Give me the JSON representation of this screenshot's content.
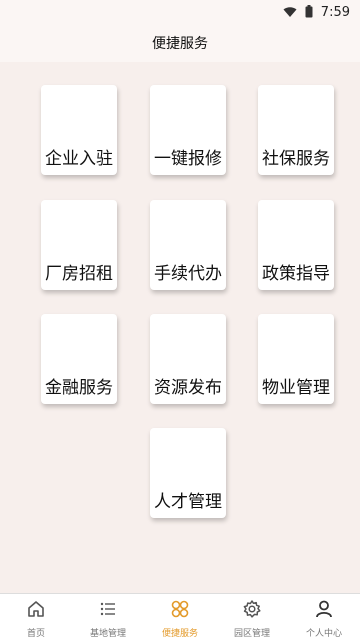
{
  "status_bar": {
    "time": "7:59",
    "icons": [
      "wifi-icon",
      "battery-icon"
    ]
  },
  "header": {
    "title": "便捷服务"
  },
  "services": [
    {
      "label": "企业入驻"
    },
    {
      "label": "一键报修"
    },
    {
      "label": "社保服务"
    },
    {
      "label": "厂房招租"
    },
    {
      "label": "手续代办"
    },
    {
      "label": "政策指导"
    },
    {
      "label": "金融服务"
    },
    {
      "label": "资源发布"
    },
    {
      "label": "物业管理"
    },
    {
      "label": "人才管理"
    }
  ],
  "tabbar": {
    "tabs": [
      {
        "label": "首页",
        "icon": "home-icon"
      },
      {
        "label": "基地管理",
        "icon": "list-icon"
      },
      {
        "label": "便捷服务",
        "icon": "services-icon",
        "active": true
      },
      {
        "label": "园区管理",
        "icon": "gear-icon"
      },
      {
        "label": "个人中心",
        "icon": "person-icon"
      }
    ]
  },
  "colors": {
    "accent": "#e39a2a",
    "background": "#f7efec",
    "card": "#ffffff"
  }
}
